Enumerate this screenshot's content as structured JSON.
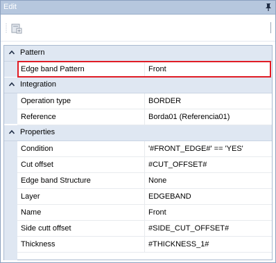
{
  "window": {
    "title": "Edit"
  },
  "categories": [
    {
      "label": "Pattern",
      "rows": [
        {
          "name": "Edge band Pattern",
          "value": "Front"
        }
      ]
    },
    {
      "label": "Integration",
      "rows": [
        {
          "name": "Operation type",
          "value": "BORDER"
        },
        {
          "name": "Reference",
          "value": "Borda01 (Referencia01)"
        }
      ]
    },
    {
      "label": "Properties",
      "rows": [
        {
          "name": "Condition",
          "value": "'#FRONT_EDGE#' == 'YES'"
        },
        {
          "name": "Cut offset",
          "value": "#CUT_OFFSET#"
        },
        {
          "name": "Edge band Structure",
          "value": "None"
        },
        {
          "name": "Layer",
          "value": "EDGEBAND"
        },
        {
          "name": "Name",
          "value": "Front"
        },
        {
          "name": "Side cutt offset",
          "value": "#SIDE_CUT_OFFSET#"
        },
        {
          "name": "Thickness",
          "value": "#THICKNESS_1#"
        }
      ]
    }
  ],
  "colors": {
    "highlight": "#e01b24",
    "category_bg": "#dfe7f2",
    "titlebar": "#b6c7de"
  },
  "icons": {
    "pin": "pin-icon",
    "toolbar": "properties-icon",
    "collapse": "chevron-up-icon"
  }
}
